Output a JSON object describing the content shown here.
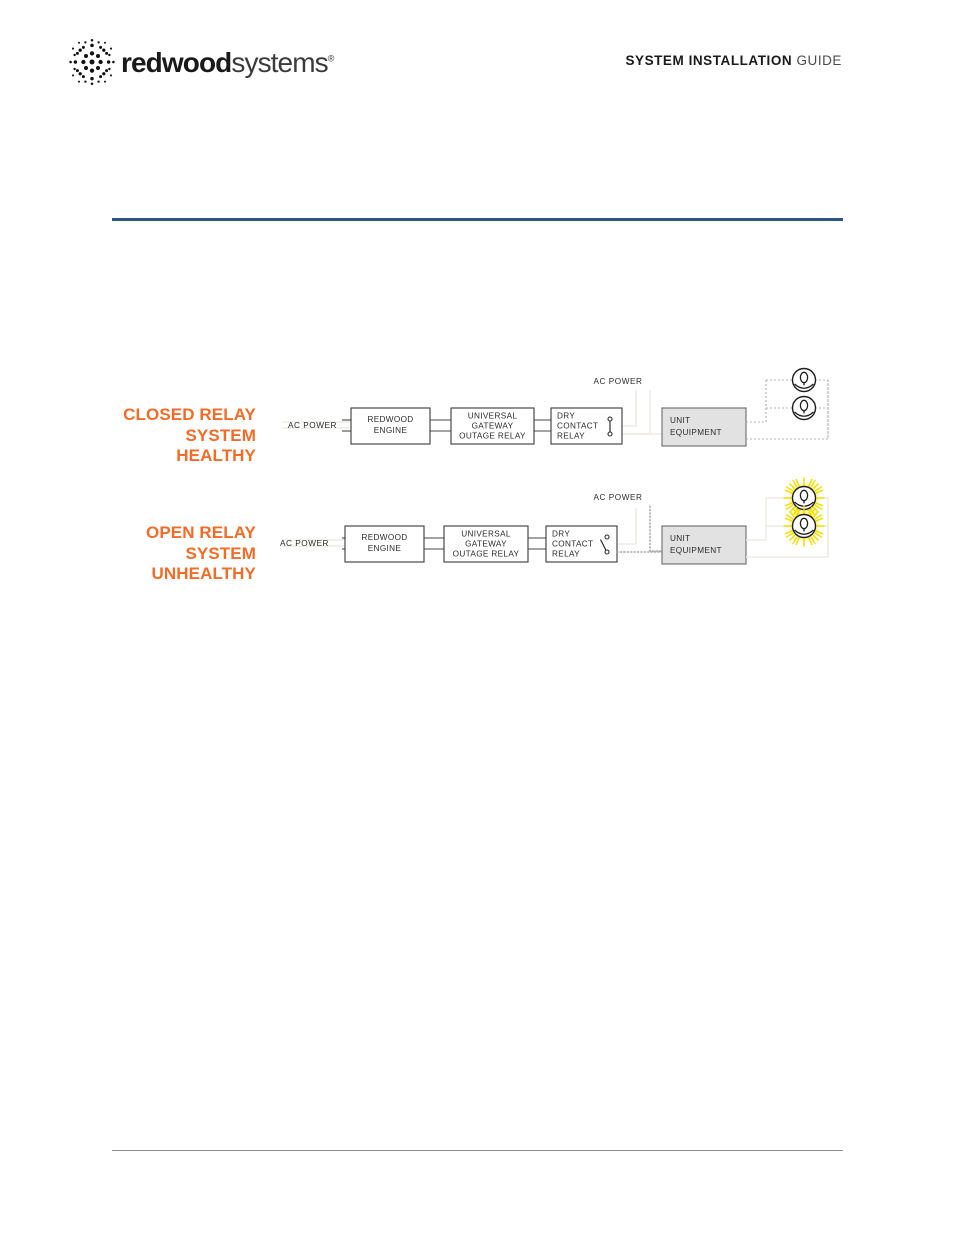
{
  "header": {
    "logo": {
      "icon": "redwood-starburst-mark",
      "word_bold": "redwood",
      "word_light": "systems",
      "registered_mark": "®"
    },
    "doc_title_bold": "SYSTEM INSTALLATION",
    "doc_title_light": "GUIDE"
  },
  "theme": {
    "accent_orange": "#f26b27",
    "rule_blue": "#2d5680",
    "rule_gray": "#8a8c8f",
    "lamp_glow_yellow": "#f5e400",
    "box_shaded_fill": "#e2e2e2"
  },
  "figure": {
    "rows": [
      {
        "id": "closed-relay",
        "state_lines": [
          "CLOSED RELAY",
          "SYSTEM",
          "HEALTHY"
        ],
        "source_label": "AC POWER",
        "mains_label": "AC POWER",
        "blocks": [
          {
            "id": "redwood-engine",
            "lines": [
              "REDWOOD",
              "ENGINE"
            ],
            "shaded": false
          },
          {
            "id": "universal-gateway",
            "lines": [
              "UNIVERSAL",
              "GATEWAY",
              "OUTAGE RELAY"
            ],
            "shaded": false
          },
          {
            "id": "dry-contact-relay",
            "lines": [
              "DRY",
              "CONTACT",
              "RELAY"
            ],
            "shaded": false
          },
          {
            "id": "unit-equipment",
            "lines": [
              "UNIT",
              "EQUIPMENT"
            ],
            "shaded": true
          }
        ],
        "relay_state": "closed",
        "lamps_lit": false,
        "lamp_count": 2
      },
      {
        "id": "open-relay",
        "state_lines": [
          "OPEN RELAY",
          "SYSTEM",
          "UNHEALTHY"
        ],
        "source_label": "AC POWER",
        "mains_label": "AC POWER",
        "blocks": [
          {
            "id": "redwood-engine",
            "lines": [
              "REDWOOD",
              "ENGINE"
            ],
            "shaded": false
          },
          {
            "id": "universal-gateway",
            "lines": [
              "UNIVERSAL",
              "GATEWAY",
              "OUTAGE RELAY"
            ],
            "shaded": false
          },
          {
            "id": "dry-contact-relay",
            "lines": [
              "DRY",
              "CONTACT",
              "RELAY"
            ],
            "shaded": false
          },
          {
            "id": "unit-equipment",
            "lines": [
              "UNIT",
              "EQUIPMENT"
            ],
            "shaded": true
          }
        ],
        "relay_state": "open",
        "lamps_lit": true,
        "lamp_count": 2
      }
    ]
  }
}
